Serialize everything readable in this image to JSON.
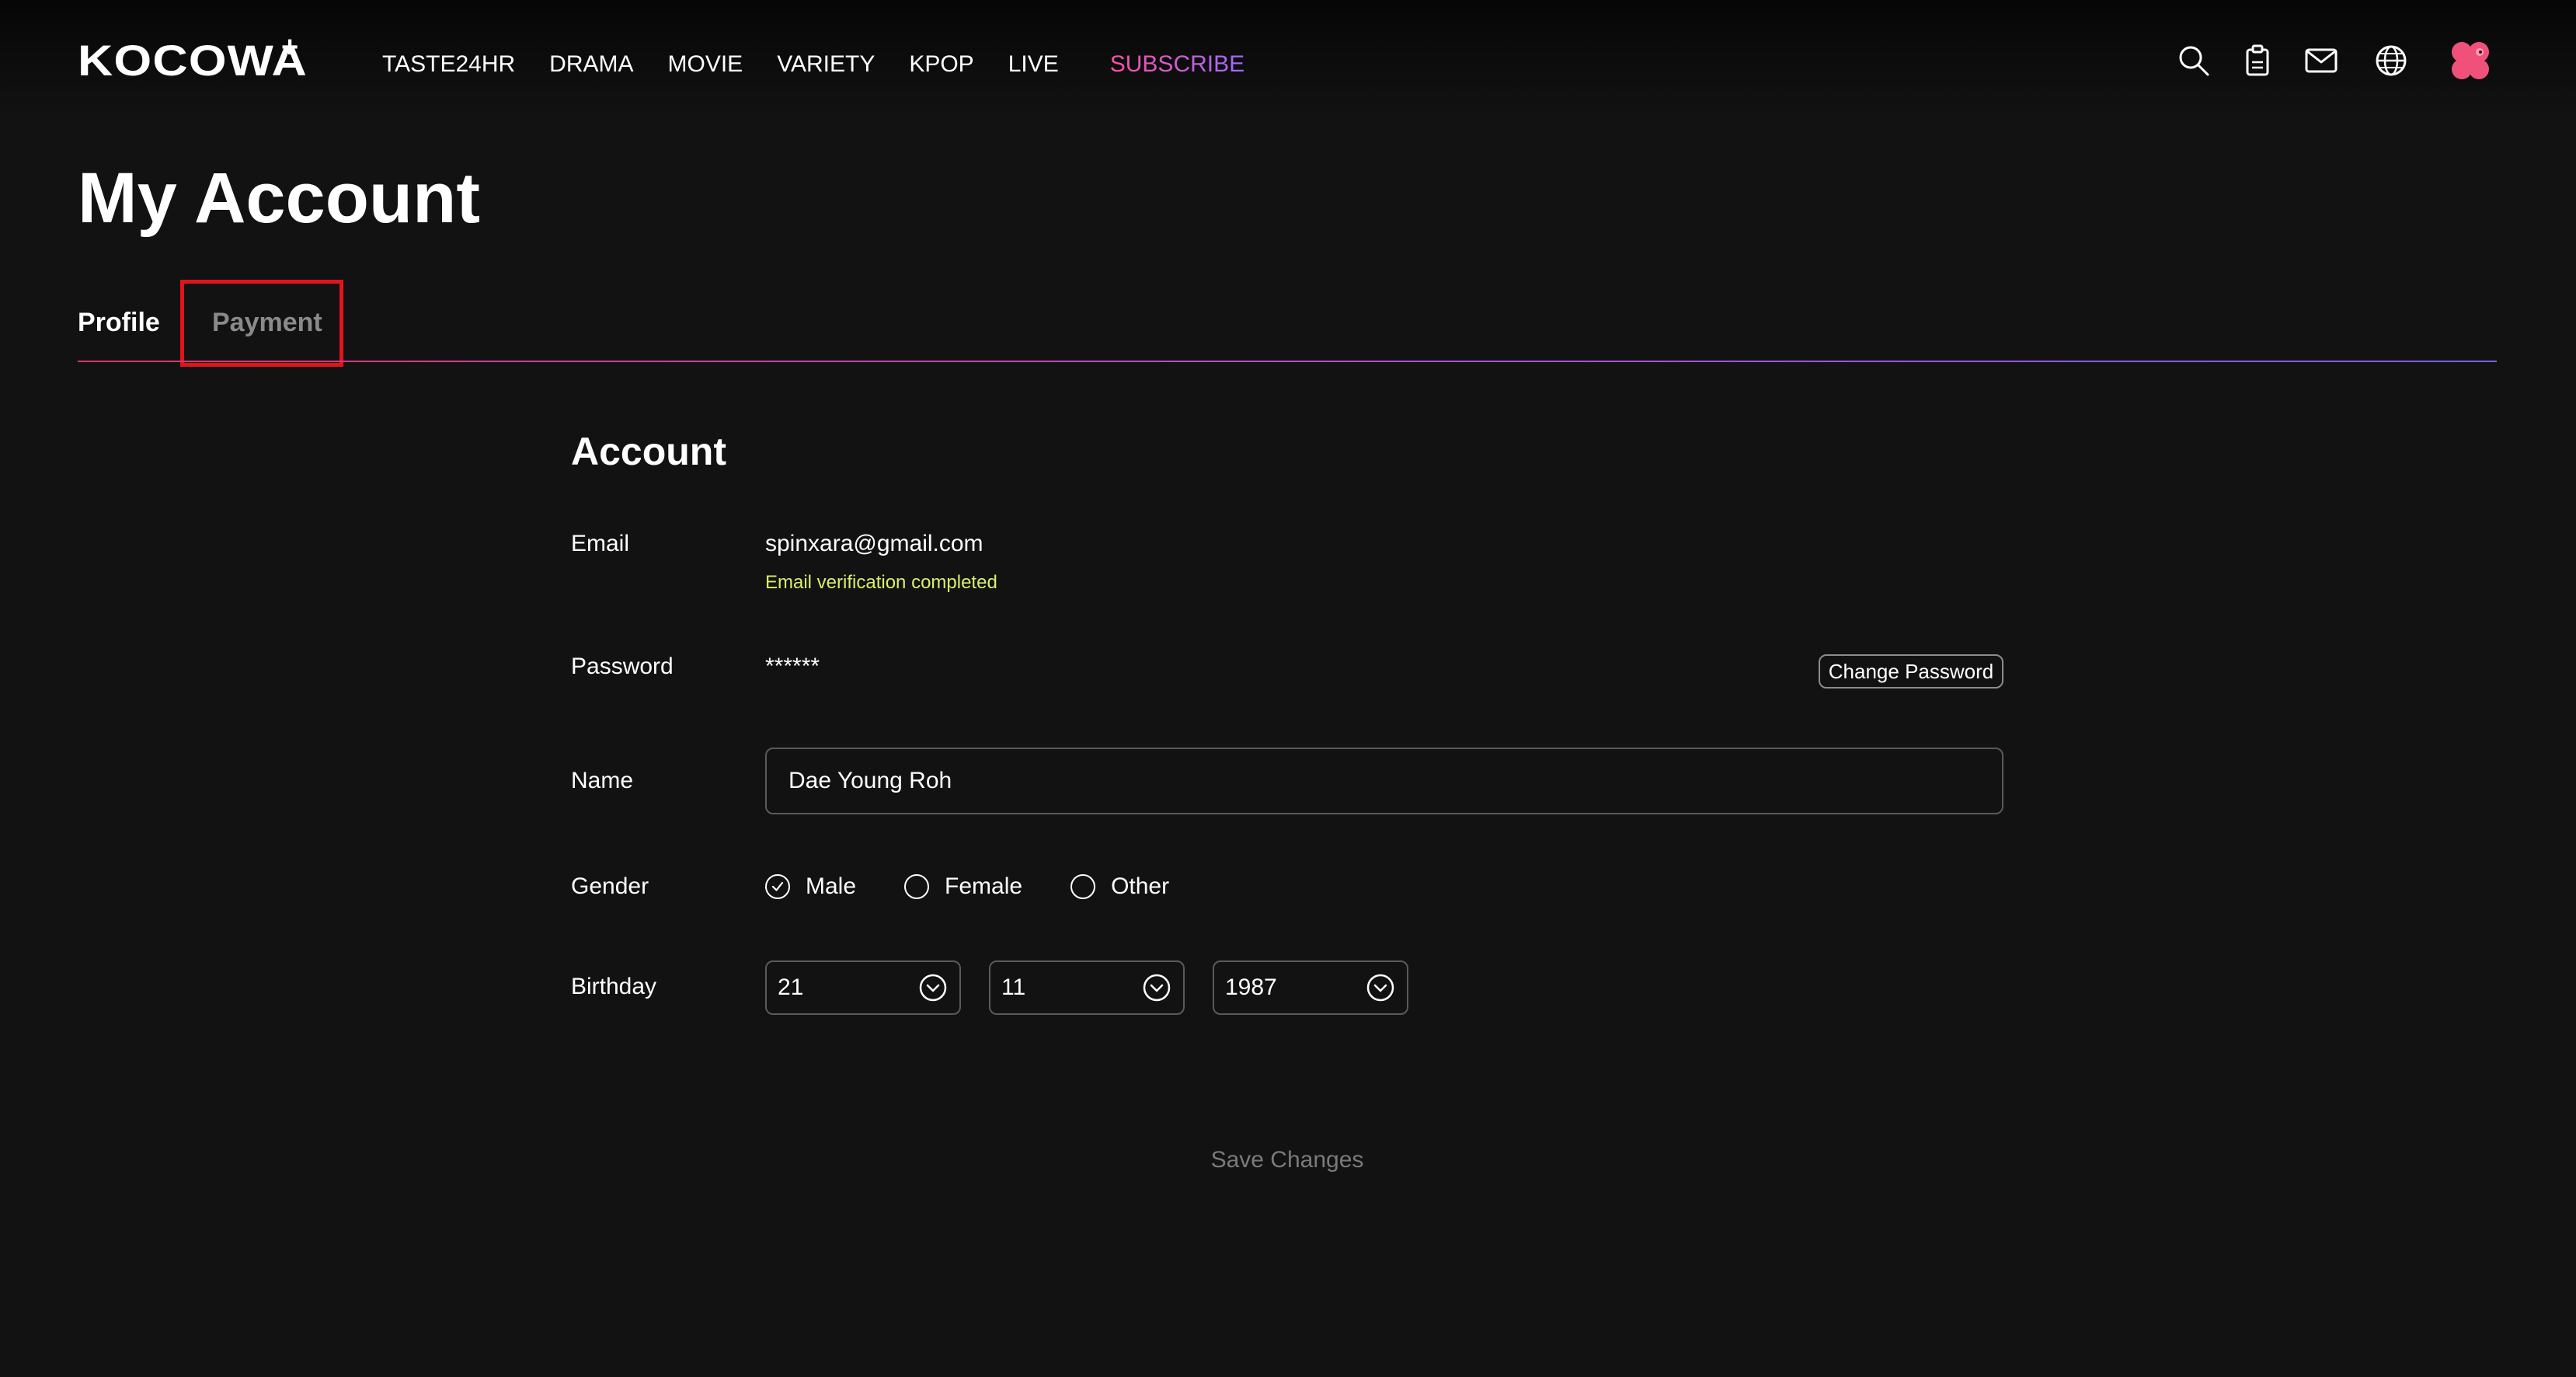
{
  "brand": {
    "logo_text": "KOCOWA",
    "logo_plus": "+"
  },
  "nav": {
    "items": [
      "TASTE24HR",
      "DRAMA",
      "MOVIE",
      "VARIETY",
      "KPOP",
      "LIVE"
    ],
    "subscribe": "SUBSCRIBE"
  },
  "header_icons": [
    "search-icon",
    "my-list-icon",
    "mail-icon",
    "globe-icon",
    "avatar"
  ],
  "page_title": "My Account",
  "tabs": {
    "profile": "Profile",
    "payment": "Payment",
    "active": "Profile"
  },
  "account": {
    "section_title": "Account",
    "email": {
      "label": "Email",
      "value": "spinxara@gmail.com",
      "status": "Email verification completed"
    },
    "password": {
      "label": "Password",
      "value": "******",
      "change_button": "Change Password"
    },
    "name": {
      "label": "Name",
      "value": "Dae Young Roh"
    },
    "gender": {
      "label": "Gender",
      "options": [
        "Male",
        "Female",
        "Other"
      ],
      "selected": "Male"
    },
    "birthday": {
      "label": "Birthday",
      "day": "21",
      "month": "11",
      "year": "1987"
    },
    "save_button": "Save Changes"
  },
  "colors": {
    "background": "#121213",
    "subscribe_gradient": [
      "#ff4fa0",
      "#9d6bff"
    ],
    "verified_text": "#d7f06a",
    "highlight_box": "#e0141b",
    "tab_inactive": "#8a8a8a",
    "save_disabled": "#7a7a7a"
  }
}
